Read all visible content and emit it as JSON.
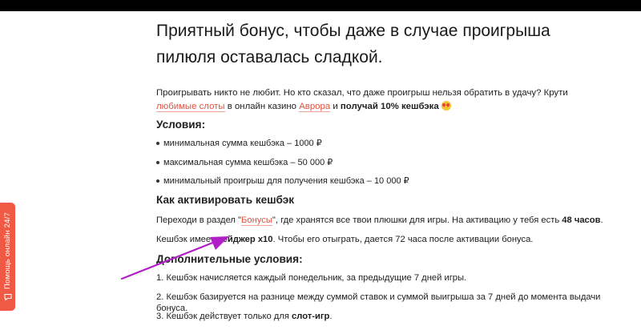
{
  "hero": {
    "title": "Приятный бонус, чтобы даже в случае проигрыша пилюля оставалась сладкой."
  },
  "intro": {
    "text_a": "Проигрывать никто не любит. Но кто сказал, что даже проигрыш нельзя обратить в удачу? Крути ",
    "link_slots": "любимые слоты",
    "text_b": " в онлайн казино ",
    "link_aurora": "Аврора",
    "text_c": " и ",
    "bold": "получай 10% кешбэка",
    "emoji": "heart-eyes-emoji"
  },
  "conditions": {
    "title": "Условия:",
    "items": [
      "минимальная сумма кешбэка – 1000 ₽",
      "максимальная сумма кешбэка – 50 000 ₽",
      "минимальный проигрыш для получения кешбэка – 10 000 ₽"
    ]
  },
  "activate": {
    "title": "Как активировать кешбэк",
    "p1_a": "Переходи в раздел \"",
    "p1_link": "Бонусы",
    "p1_b": "\", где хранятся все твои плюшки для игры. На активацию у тебя есть ",
    "p1_bold": "48 часов",
    "p1_c": ".",
    "p2_a": "Кешбэк имеет ",
    "p2_bold": "вейджер х10",
    "p2_b": ". Чтобы его отыграть, дается 72 часа после активации бонуса."
  },
  "extra": {
    "title": "Дополнительные условия:",
    "item1": "1. Кешбэк начисляется каждый понедельник, за предыдущие 7 дней игры.",
    "item2": "2. Кешбэк базируется на разнице между суммой ставок и суммой выигрыша за 7 дней до момента выдачи бонуса.",
    "item3_a": "3. Кешбэк действует только для ",
    "item3_bold": "слот-игр",
    "item3_b": "."
  },
  "help_widget": {
    "label": "Помощь онлайн 24/7",
    "icon": "chat-icon"
  },
  "colors": {
    "accent": "#e0523f",
    "help_bg": "#f05a44",
    "annotation_arrow": "#b21fc8",
    "topbar": "#000000"
  }
}
